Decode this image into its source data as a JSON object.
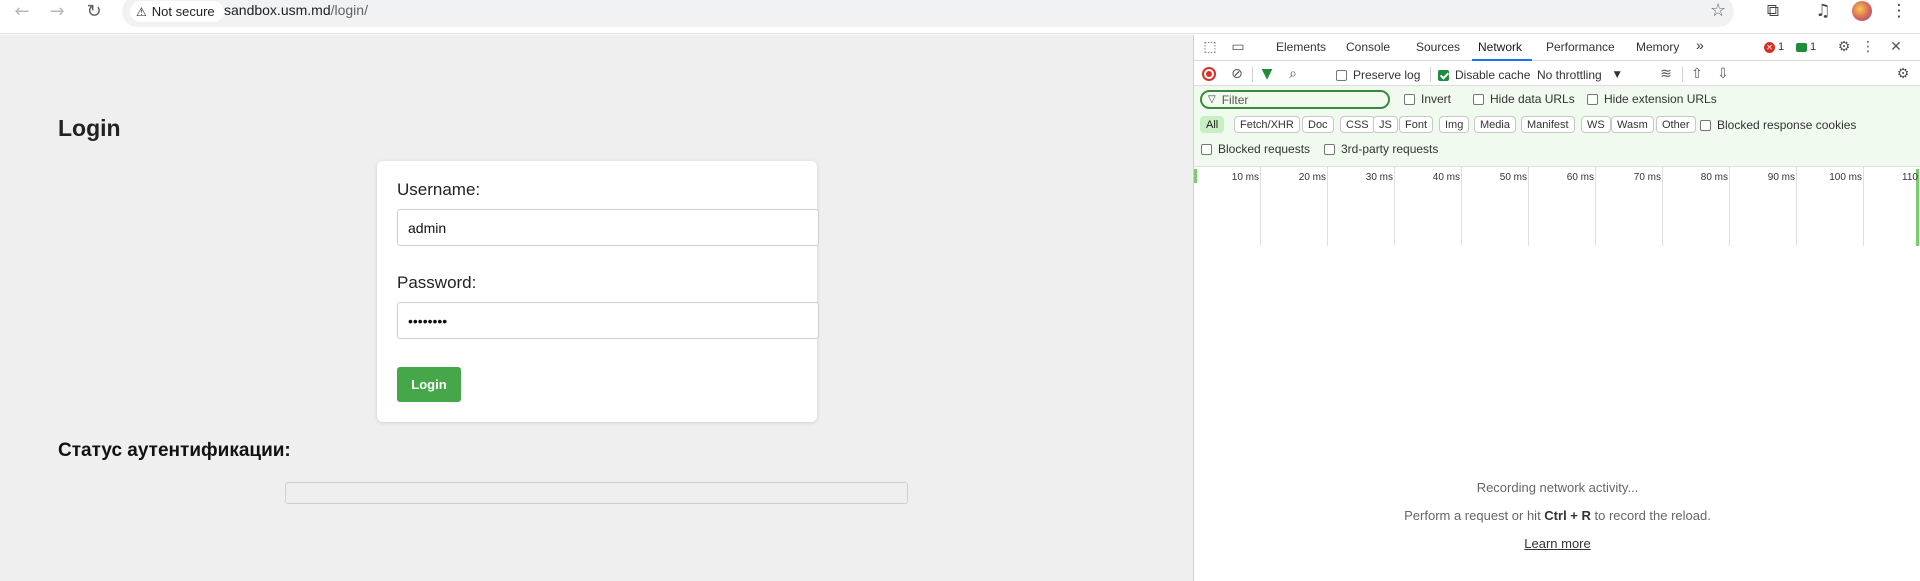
{
  "browser": {
    "back_icon": "arrow-left-icon",
    "forward_icon": "arrow-right-icon",
    "reload_icon": "reload-icon",
    "security_label": "Not secure",
    "url_host": "sandbox.usm.md",
    "url_path": "/login/"
  },
  "page": {
    "title": "Login",
    "username_label": "Username:",
    "username_value": "admin",
    "password_label": "Password:",
    "password_value": "••••••••",
    "login_button": "Login",
    "status_title": "Статус аутентификации:",
    "status_value": ""
  },
  "devtools": {
    "tabs": [
      "Elements",
      "Console",
      "Sources",
      "Network",
      "Performance",
      "Memory"
    ],
    "active_tab": "Network",
    "more_tabs": "»",
    "error_count": "1",
    "message_count": "1",
    "toolbar": {
      "preserve_log": "Preserve log",
      "preserve_log_checked": false,
      "disable_cache": "Disable cache",
      "disable_cache_checked": true,
      "throttling": "No throttling"
    },
    "filter": {
      "placeholder": "Filter",
      "invert": "Invert",
      "hide_data_urls": "Hide data URLs",
      "hide_extension_urls": "Hide extension URLs",
      "chips": [
        "All",
        "Fetch/XHR",
        "Doc",
        "CSS",
        "JS",
        "Font",
        "Img",
        "Media",
        "Manifest",
        "WS",
        "Wasm",
        "Other"
      ],
      "active_chip": "All",
      "blocked_response_cookies": "Blocked response cookies",
      "blocked_requests": "Blocked requests",
      "third_party_requests": "3rd-party requests"
    },
    "timeline_ticks": [
      "10 ms",
      "20 ms",
      "30 ms",
      "40 ms",
      "50 ms",
      "60 ms",
      "70 ms",
      "80 ms",
      "90 ms",
      "100 ms",
      "110"
    ],
    "empty_state": {
      "line1": "Recording network activity...",
      "line2_prefix": "Perform a request or hit ",
      "line2_keys": "Ctrl + R",
      "line2_suffix": " to record the reload.",
      "learn_more": "Learn more"
    },
    "colors": {
      "accent": "#1a73e8",
      "record": "#d93025",
      "filter_bg": "#f1faef",
      "chip_active": "#c8efc3"
    }
  }
}
